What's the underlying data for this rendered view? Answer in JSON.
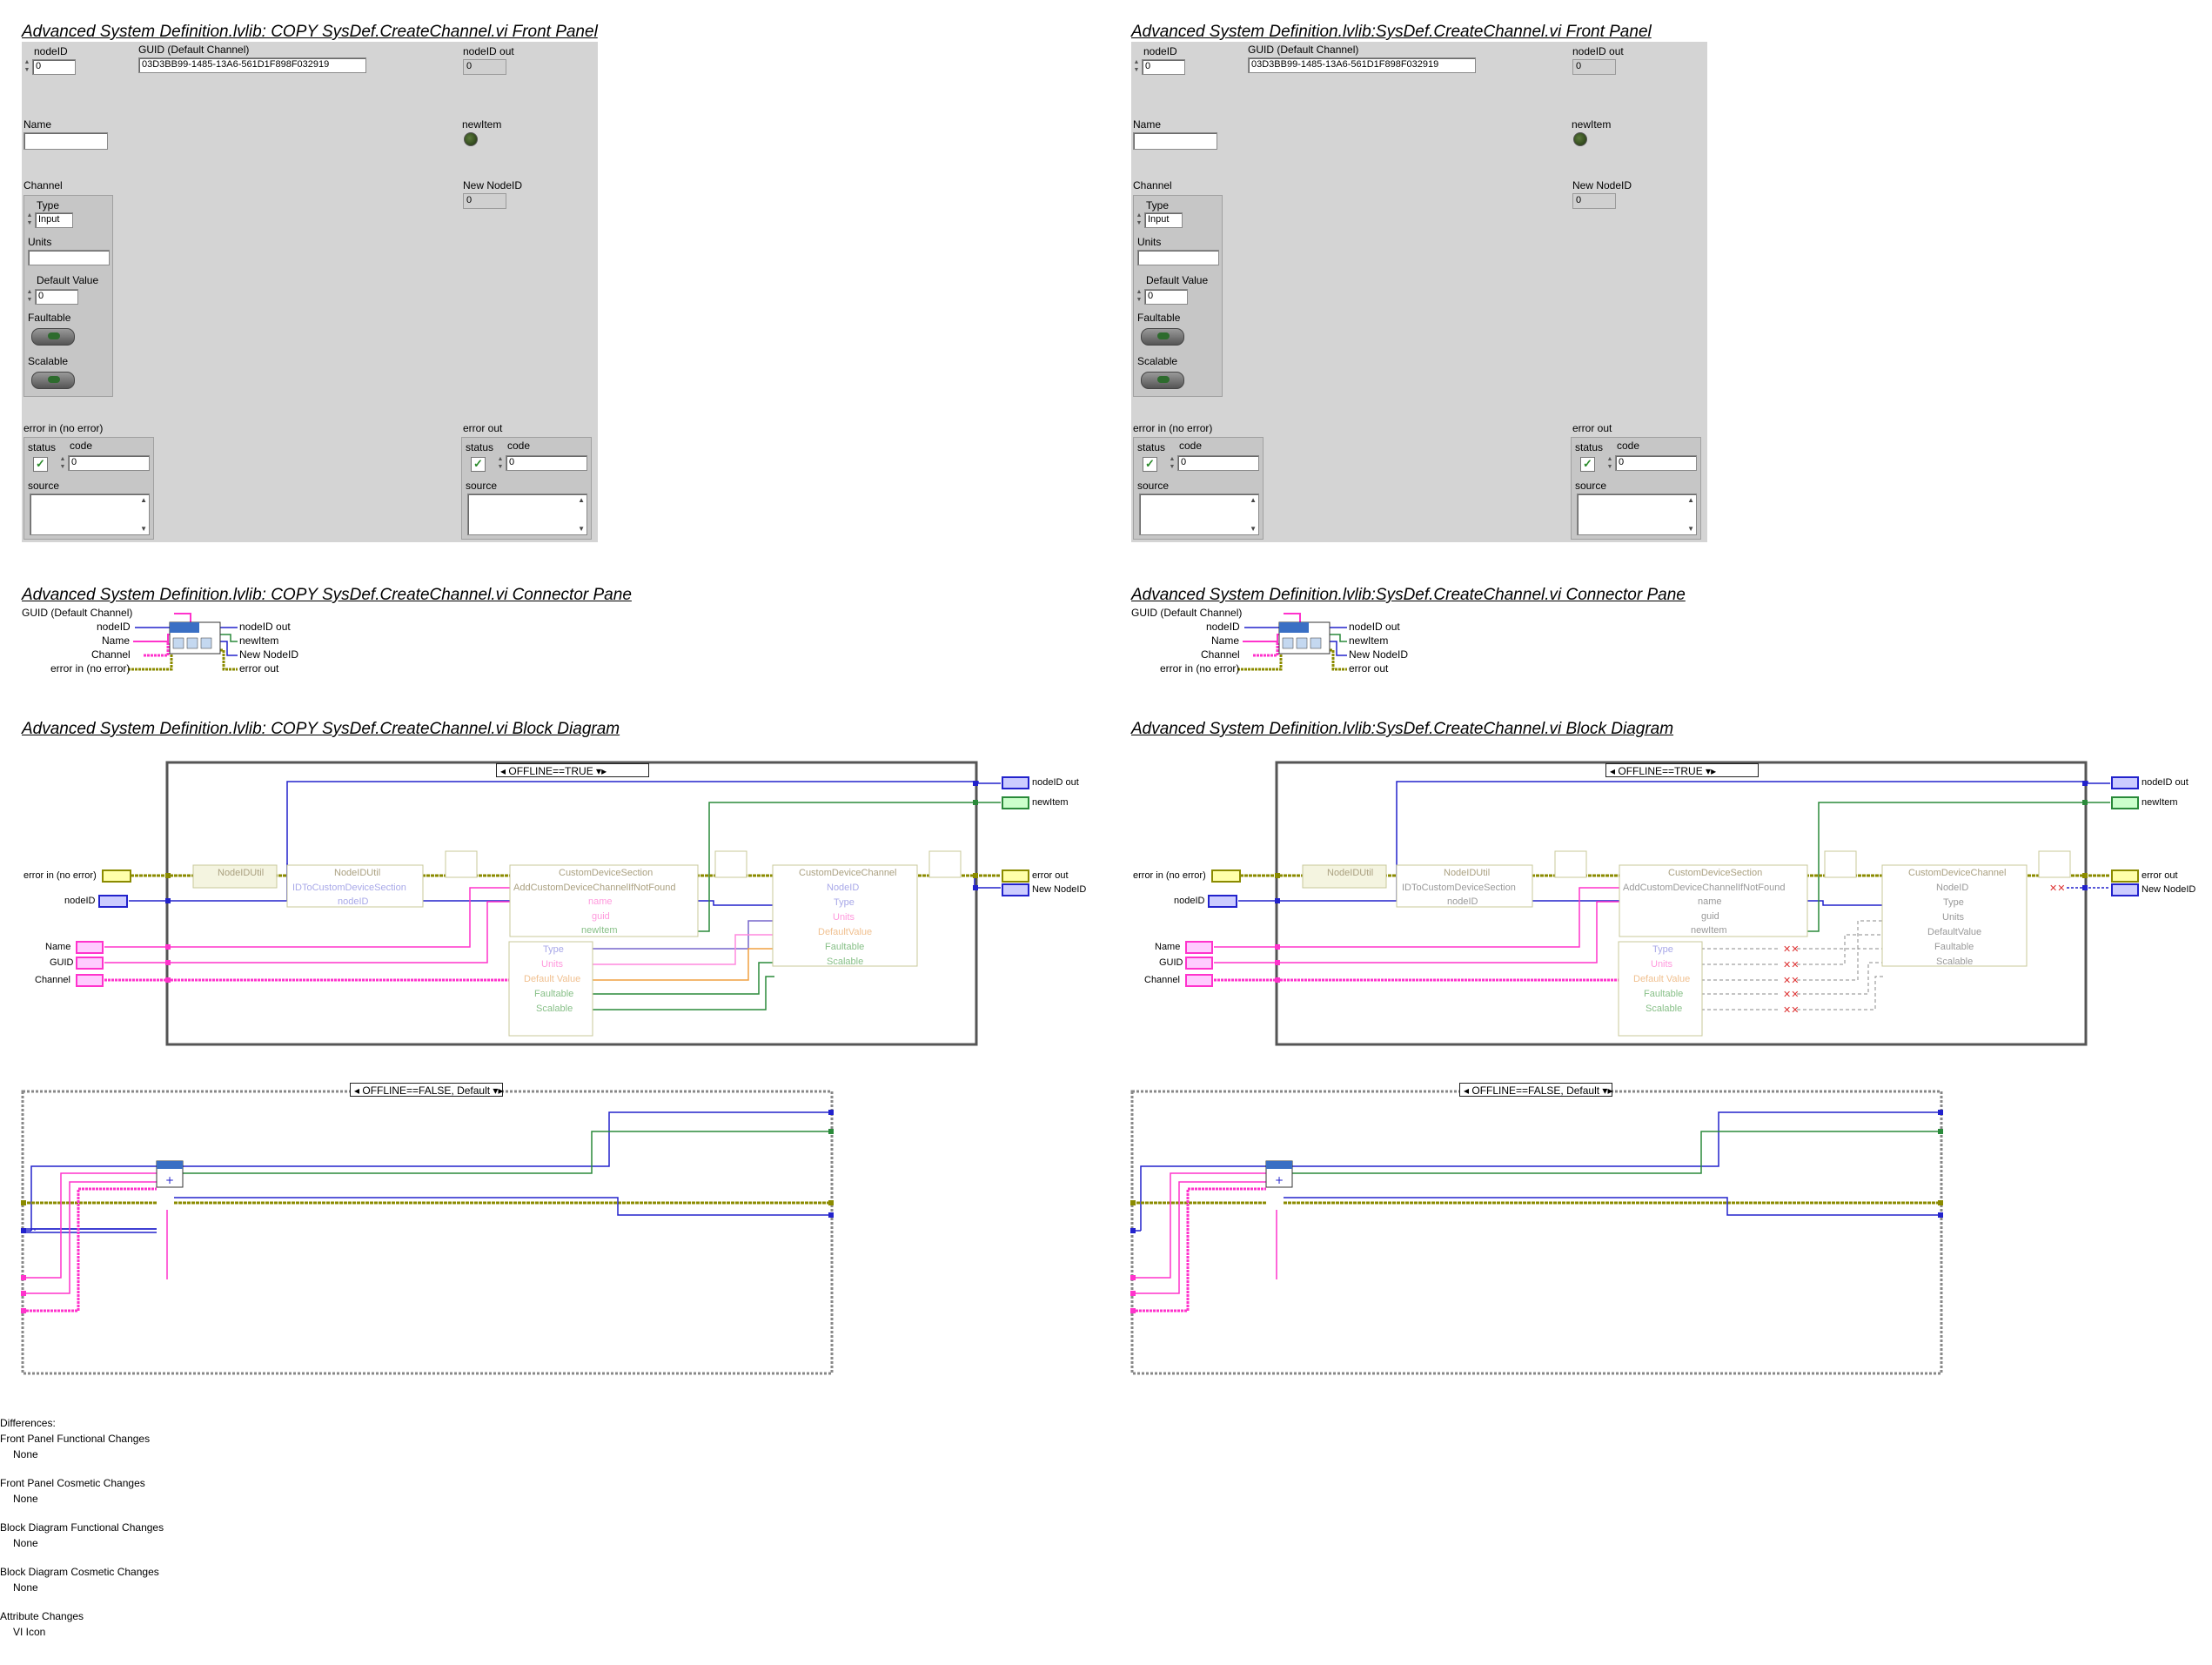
{
  "left": {
    "front_panel_title": "Advanced System Definition.lvlib:  COPY  SysDef.CreateChannel.vi Front Panel",
    "connector_title": "Advanced System Definition.lvlib:  COPY  SysDef.CreateChannel.vi Connector Pane",
    "block_title": "Advanced System Definition.lvlib:  COPY  SysDef.CreateChannel.vi Block Diagram"
  },
  "right": {
    "front_panel_title": "Advanced System Definition.lvlib:SysDef.CreateChannel.vi Front Panel",
    "connector_title": "Advanced System Definition.lvlib:SysDef.CreateChannel.vi Connector Pane",
    "block_title": "Advanced System Definition.lvlib:SysDef.CreateChannel.vi Block Diagram"
  },
  "front_panel": {
    "nodeid_label": "nodeID",
    "nodeid_value": "0",
    "guid_label": "GUID (Default Channel)",
    "guid_value": "03D3BB99-1485-13A6-561D1F898F032919",
    "nodeid_out_label": "nodeID out",
    "nodeid_out_value": "0",
    "name_label": "Name",
    "name_value": "",
    "newitem_label": "newItem",
    "channel_label": "Channel",
    "new_nodeid_label": "New NodeID",
    "new_nodeid_value": "0",
    "type_label": "Type",
    "type_value": "Input",
    "units_label": "Units",
    "units_value": "",
    "default_value_label": "Default Value",
    "default_value": "0",
    "faultable_label": "Faultable",
    "scalable_label": "Scalable",
    "error_in_label": "error in (no error)",
    "error_out_label": "error out",
    "status_label": "status",
    "code_label": "code",
    "code_value": "0",
    "source_label": "source",
    "check_glyph": "✓"
  },
  "connector": {
    "inputs": [
      "GUID (Default Channel)",
      "nodeID",
      "Name",
      "Channel",
      "error in (no error)"
    ],
    "outputs": [
      "nodeID out",
      "newItem",
      "New NodeID",
      "error out"
    ]
  },
  "block": {
    "case_true": "OFFLINE==TRUE",
    "case_false": "OFFLINE==FALSE, Default",
    "inputs": [
      "error in (no error)",
      "nodeID",
      "Name",
      "GUID",
      "Channel"
    ],
    "outputs": [
      "nodeID out",
      "newItem",
      "error out",
      "New NodeID"
    ],
    "node1": "NodeIDUtil",
    "node2": "NodeIDUtil",
    "node2_method": "IDToCustomDeviceSection",
    "node2_param": "nodeID",
    "node3": "CustomDeviceSection",
    "node3_method": "AddCustomDeviceChannelIfNotFound",
    "node3_params": [
      "name",
      "guid",
      "newItem"
    ],
    "unbundle": [
      "Type",
      "Units",
      "Default Value",
      "Faultable",
      "Scalable"
    ],
    "node4": "CustomDeviceChannel",
    "node4_params": [
      "NodeID",
      "Type",
      "Units",
      "DefaultValue",
      "Faultable",
      "Scalable"
    ],
    "term_i32": "I32",
    "term_tf": "TF",
    "term_abc": "abc",
    "term_err": "■■"
  },
  "differences": {
    "heading": "Differences:",
    "items": [
      {
        "title": "Front Panel Functional Changes",
        "value": "None"
      },
      {
        "title": "Front Panel Cosmetic Changes",
        "value": "None"
      },
      {
        "title": "Block Diagram Functional Changes",
        "value": "None"
      },
      {
        "title": "Block Diagram Cosmetic Changes",
        "value": "None"
      },
      {
        "title": "Attribute Changes",
        "value": "VI Icon"
      }
    ]
  },
  "colors": {
    "panel_bg": "#d4d4d4",
    "wire_blue": "#2222cc",
    "wire_green": "#2a8a3a",
    "wire_pink": "#ff33cc",
    "wire_error": "#8b8b00",
    "wire_orange": "#f0a040",
    "node_tan": "#c8c89a"
  }
}
